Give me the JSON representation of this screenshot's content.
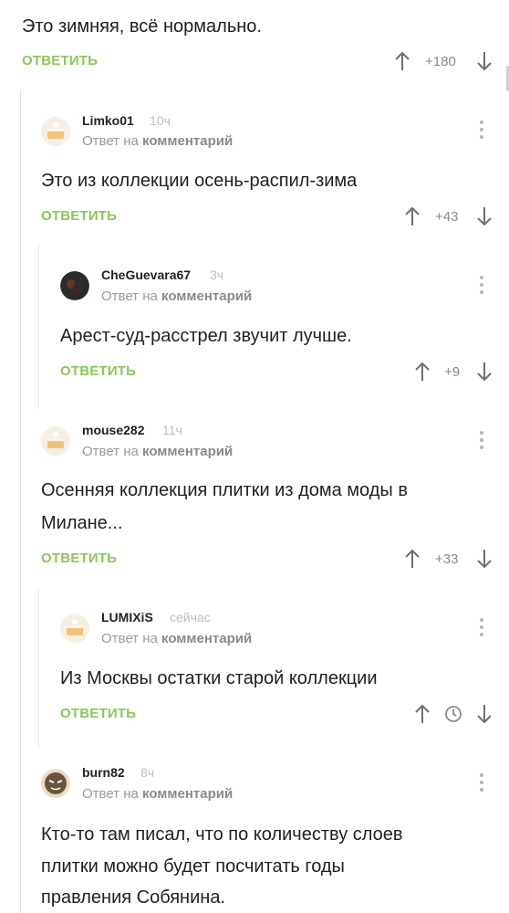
{
  "top": {
    "text": "Это зимняя, всё нормально.",
    "reply": "ОТВЕТИТЬ",
    "rating": "+180"
  },
  "c1": {
    "user": "Limko01",
    "time": "10ч",
    "sub_prefix": "Ответ на",
    "sub_link": "комментарий",
    "text": "Это из коллекции осень-распил-зима",
    "reply": "ОТВЕТИТЬ",
    "rating": "+43"
  },
  "c2": {
    "user": "CheGuevara67",
    "time": "3ч",
    "sub_prefix": "Ответ на",
    "sub_link": "комментарий",
    "text": "Арест-суд-расстрел звучит лучше.",
    "reply": "ОТВЕТИТЬ",
    "rating": "+9"
  },
  "c3": {
    "user": "mouse282",
    "time": "11ч",
    "sub_prefix": "Ответ на",
    "sub_link": "комментарий",
    "text_line1": "Осенняя коллекция плитки из дома моды в",
    "text_line2": "Милане...",
    "reply": "ОТВЕТИТЬ",
    "rating": "+33"
  },
  "c4": {
    "user": "LUMIXiS",
    "time": "сейчас",
    "sub_prefix": "Ответ на",
    "sub_link": "комментарий",
    "text": "Из Москвы остатки старой коллекции",
    "reply": "ОТВЕТИТЬ"
  },
  "c5": {
    "user": "burn82",
    "time": "8ч",
    "sub_prefix": "Ответ на",
    "sub_link": "комментарий",
    "text_line1": "Кто-то там писал, что по количеству слоев",
    "text_line2": "плитки можно будет посчитать годы",
    "text_line3": "правления Собянина."
  },
  "colors": {
    "accent": "#8ac858",
    "muted": "#9a9a9a",
    "thread_line": "#e4e4e4"
  },
  "icons": [
    "upvote-arrow-icon",
    "downvote-arrow-icon",
    "more-vertical-icon",
    "clock-icon",
    "cake-avatar-icon"
  ]
}
